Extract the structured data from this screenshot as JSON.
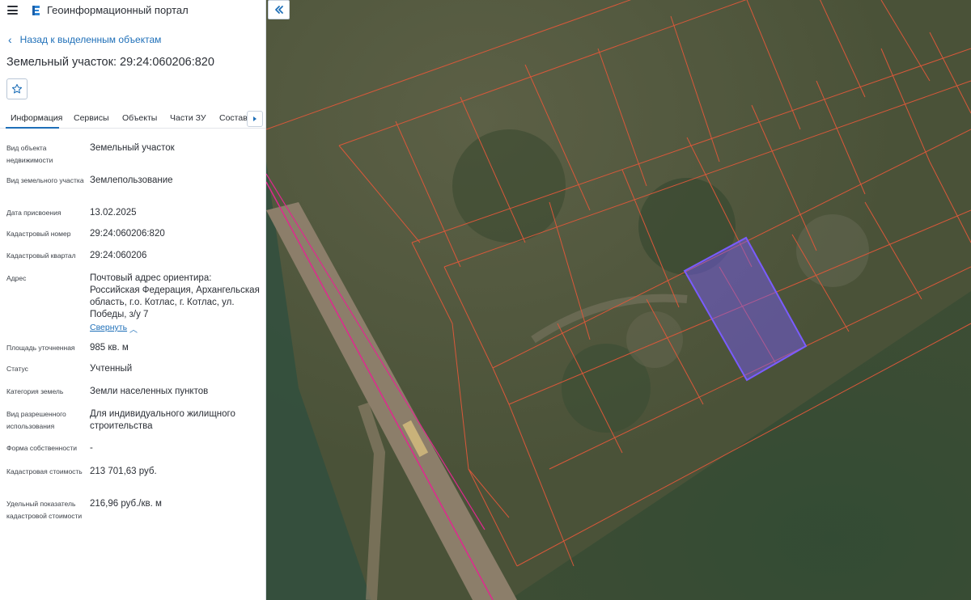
{
  "app": {
    "title": "Геоинформационный портал"
  },
  "nav": {
    "back_label": "Назад к выделенным объектам"
  },
  "page": {
    "title": "Земельный участок: 29:24:060206:820"
  },
  "tabs": [
    {
      "label": "Информация"
    },
    {
      "label": "Сервисы"
    },
    {
      "label": "Объекты"
    },
    {
      "label": "Части ЗУ"
    },
    {
      "label": "Состав"
    }
  ],
  "fields": {
    "object_type": {
      "label": "Вид объекта недвижимости",
      "value": "Земельный участок"
    },
    "land_type": {
      "label": "Вид земельного участка",
      "value": "Землепользование"
    },
    "assign_date": {
      "label": "Дата присвоения",
      "value": "13.02.2025"
    },
    "cadastral_number": {
      "label": "Кадастровый номер",
      "value": "29:24:060206:820"
    },
    "cadastral_quarter": {
      "label": "Кадастровый квартал",
      "value": "29:24:060206"
    },
    "address": {
      "label": "Адрес",
      "value": "Почтовый адрес ориентира: Российская Федерация, Архангельская область, г.о. Котлас, г. Котлас, ул. Победы, з/у 7",
      "collapse_label": "Свернуть"
    },
    "area": {
      "label": "Площадь уточненная",
      "value": "985 кв. м"
    },
    "status": {
      "label": "Статус",
      "value": "Учтенный"
    },
    "category": {
      "label": "Категория земель",
      "value": "Земли населенных пунктов"
    },
    "permitted_use": {
      "label": "Вид разрешенного использования",
      "value": "Для индивидуального жилищного строительства"
    },
    "ownership": {
      "label": "Форма собственности",
      "value": "-"
    },
    "cadastral_value": {
      "label": "Кадастровая стоимость",
      "value": "213 701,63 руб."
    },
    "specific_value": {
      "label": "Удельный показатель кадастровой стоимости",
      "value": "216,96 руб./кв. м"
    }
  },
  "colors": {
    "accent": "#1e6fb8",
    "parcel_boundary": "#d9583a",
    "selected_parcel": "#7a5cff",
    "road_line": "#e0288f"
  },
  "icons": {
    "menu": "hamburger-icon",
    "logo": "portal-logo-icon",
    "back": "chevron-left-icon",
    "favorite": "star-icon",
    "tabs_next": "triangle-right-icon",
    "collapse": "chevron-up-icon",
    "collapse_panel": "double-chevron-left-icon"
  }
}
